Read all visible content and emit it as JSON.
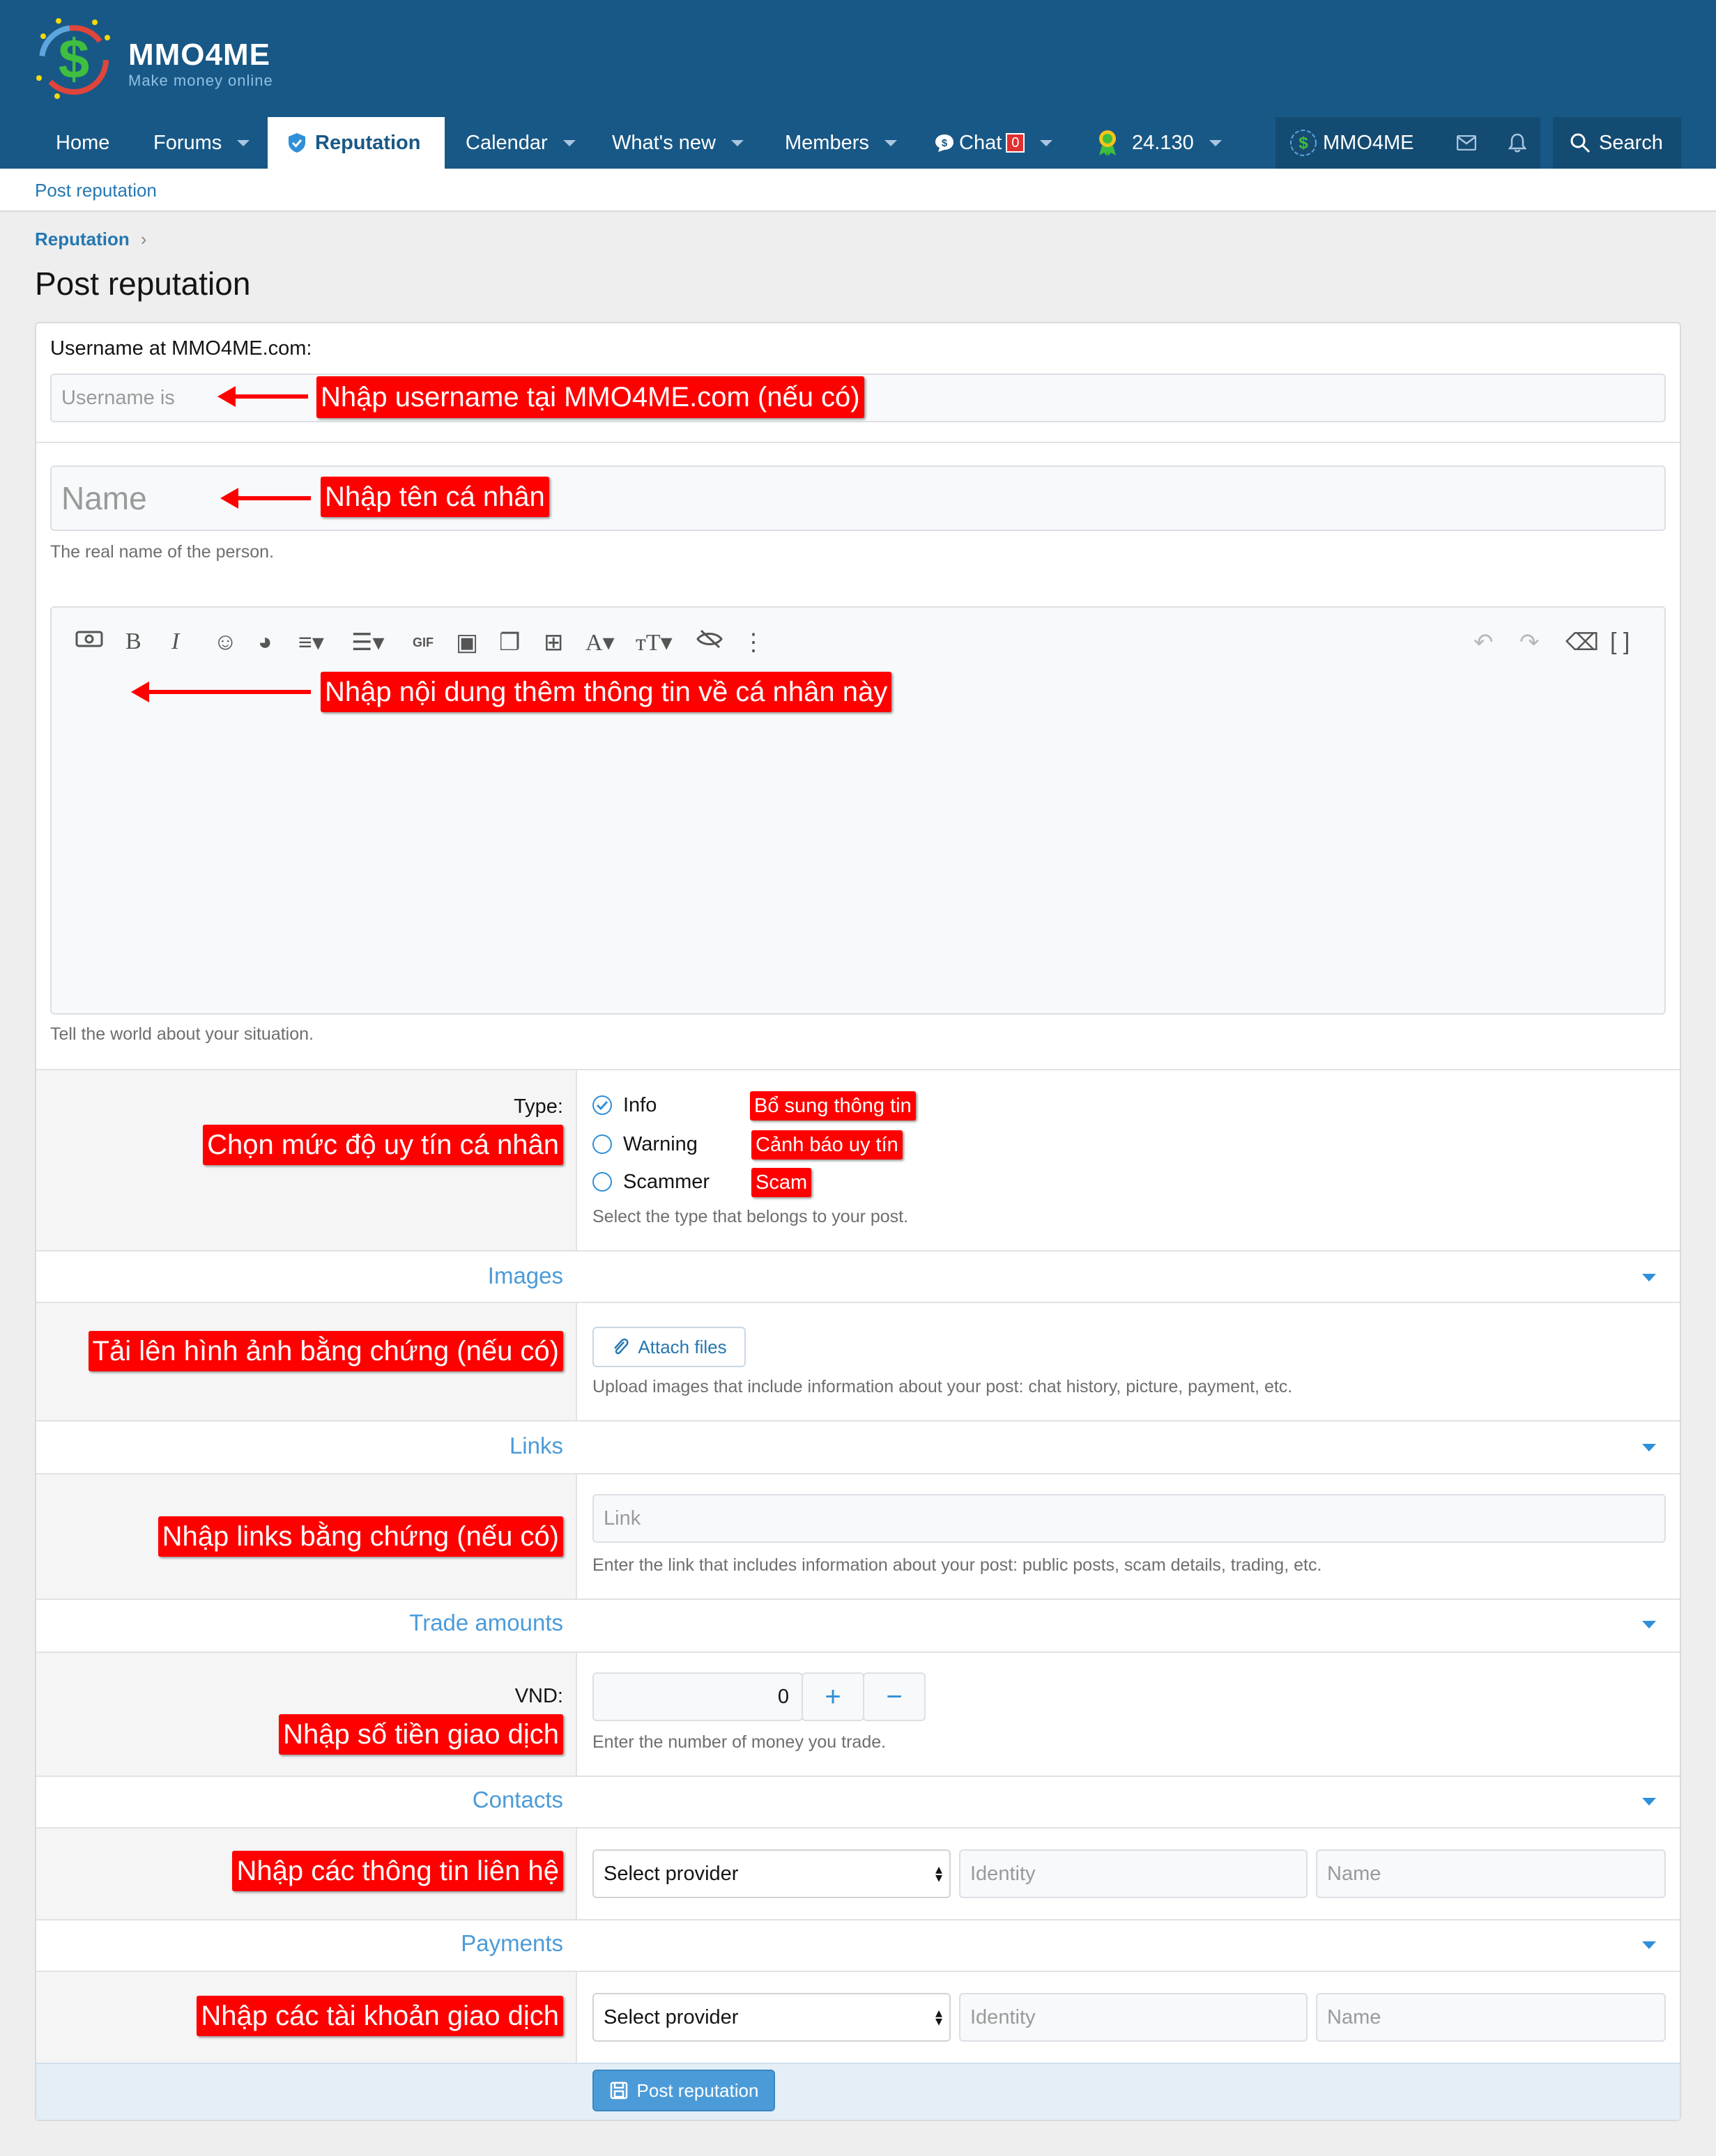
{
  "header": {
    "logo_title": "MMO4ME",
    "logo_subtitle": "Make money online",
    "nav": [
      {
        "label": "Home"
      },
      {
        "label": "Forums"
      },
      {
        "label": "Reputation"
      },
      {
        "label": "Calendar"
      },
      {
        "label": "What's new"
      },
      {
        "label": "Members"
      },
      {
        "label": "Chat",
        "badge": "0"
      },
      {
        "label": "24.130"
      },
      {
        "label": "MMO4ME"
      },
      {
        "label": "Search"
      }
    ]
  },
  "subnav": {
    "item": "Post reputation"
  },
  "breadcrumb": "Reputation",
  "page_title": "Post reputation",
  "form": {
    "username_label": "Username at MMO4ME.com:",
    "username_placeholder": "Username is",
    "name_placeholder": "Name",
    "name_hint": "The real name of the person.",
    "editor_hint": "Tell the world about your situation.",
    "type_label": "Type:",
    "type_options": [
      {
        "label": "Info",
        "checked": true
      },
      {
        "label": "Warning",
        "checked": false
      },
      {
        "label": "Scammer",
        "checked": false
      }
    ],
    "type_hint": "Select the type that belongs to your post.",
    "images_section": "Images",
    "attach_label": "Attach files",
    "images_hint": "Upload images that include information about your post: chat history, picture, payment, etc.",
    "links_section": "Links",
    "link_placeholder": "Link",
    "links_hint": "Enter the link that includes information about your post: public posts, scam details, trading, etc.",
    "trade_section": "Trade amounts",
    "vnd_label": "VND:",
    "vnd_value": "0",
    "plus": "+",
    "minus": "−",
    "trade_hint": "Enter the number of money you trade.",
    "contacts_section": "Contacts",
    "contacts_select": "Select provider",
    "contacts_identity": "Identity",
    "contacts_name": "Name",
    "payments_section": "Payments",
    "payments_select": "Select provider",
    "payments_identity": "Identity",
    "payments_name": "Name",
    "submit_label": "Post reputation"
  },
  "annotations": {
    "username": "Nhập username tại MMO4ME.com (nếu có)",
    "name": "Nhập tên cá nhân",
    "content": "Nhập nội dung thêm thông tin về cá nhân này",
    "type": "Chọn mức độ uy tín cá nhân",
    "info": "Bổ sung thông tin",
    "warning": "Cảnh báo uy tín",
    "scammer": "Scam",
    "images": "Tải lên hình ảnh bằng chứng (nếu có)",
    "links": "Nhập links bằng chứng (nếu có)",
    "trade": "Nhập số tiền giao dịch",
    "contacts": "Nhập các thông tin liên hệ",
    "payments": "Nhập các tài khoản giao dịch"
  },
  "colors": {
    "header": "#185886",
    "accent": "#2f8fd8",
    "callout": "#ff0000"
  }
}
